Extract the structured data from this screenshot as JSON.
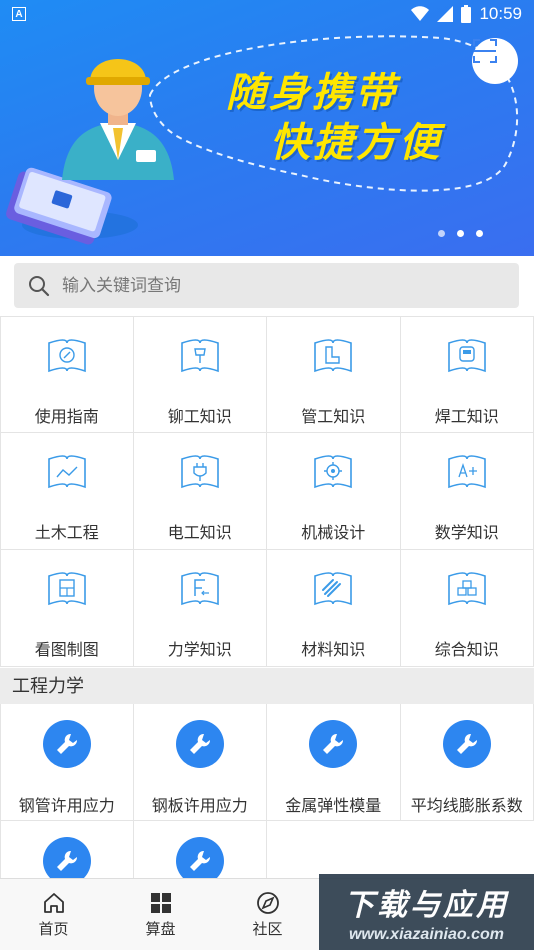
{
  "status_bar": {
    "time": "10:59",
    "notification_badge": "A"
  },
  "banner": {
    "slogan_line1": "随身携带",
    "slogan_line2": "快捷方便",
    "slogan_color": "#ffe600",
    "scan_icon": "scan-icon",
    "page_count": 3,
    "active_page": 0
  },
  "search": {
    "placeholder": "输入关键词查询"
  },
  "categories": [
    {
      "label": "使用指南",
      "icon": "compass-icon"
    },
    {
      "label": "铆工知识",
      "icon": "rivet-icon"
    },
    {
      "label": "管工知识",
      "icon": "pipe-icon"
    },
    {
      "label": "焊工知识",
      "icon": "welding-mask-icon"
    },
    {
      "label": "土木工程",
      "icon": "terrain-icon"
    },
    {
      "label": "电工知识",
      "icon": "plug-icon"
    },
    {
      "label": "机械设计",
      "icon": "gear-icon"
    },
    {
      "label": "数学知识",
      "icon": "formula-icon"
    },
    {
      "label": "看图制图",
      "icon": "drawing-icon"
    },
    {
      "label": "力学知识",
      "icon": "force-icon"
    },
    {
      "label": "材料知识",
      "icon": "steel-bars-icon"
    },
    {
      "label": "综合知识",
      "icon": "cubes-icon"
    }
  ],
  "section": {
    "title": "工程力学"
  },
  "calculators": [
    {
      "label": "钢管许用应力"
    },
    {
      "label": "钢板许用应力"
    },
    {
      "label": "金属弹性模量"
    },
    {
      "label": "平均线膨胀系数"
    },
    {
      "label": ""
    },
    {
      "label": ""
    }
  ],
  "bottom_nav": [
    {
      "label": "首页",
      "icon": "home-icon"
    },
    {
      "label": "算盘",
      "icon": "grid-icon"
    },
    {
      "label": "社区",
      "icon": "compass-nav-icon"
    }
  ],
  "watermark": {
    "line1": "下载与应用",
    "line2": "www.xiazainiao.com"
  },
  "colors": {
    "primary": "#2d86f0",
    "icon_line": "#3b9be8"
  }
}
